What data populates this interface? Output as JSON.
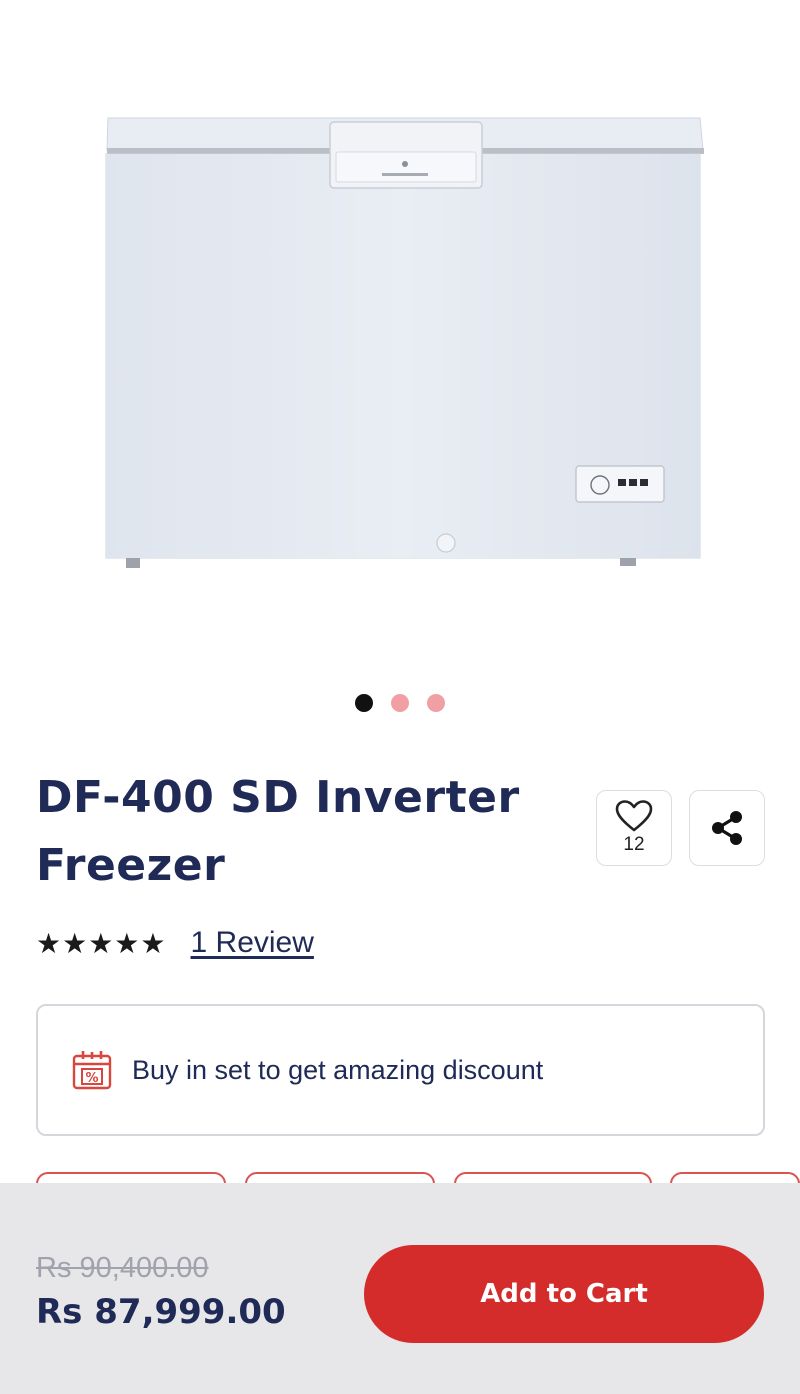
{
  "gallery": {
    "image_alt": "DF-400 SD Inverter Freezer",
    "slide_count": 3,
    "active_slide": 1
  },
  "product": {
    "title": "DF-400 SD Inverter Freezer",
    "wishlist_count": "12",
    "rating_stars": "★★★★★",
    "rating_value": 5,
    "review_link": "1 Review"
  },
  "promo": {
    "text": "Buy in set to get amazing discount",
    "icon": "calendar-percent-icon"
  },
  "bottom_bar": {
    "old_price": "Rs 90,400.00",
    "new_price": "Rs 87,999.00",
    "add_to_cart": "Add to Cart"
  },
  "colors": {
    "brand_navy": "#1f2a56",
    "accent_red": "#d42b2b",
    "dot_inactive": "#f0a0a4",
    "bar_bg": "#e7e7e9"
  }
}
